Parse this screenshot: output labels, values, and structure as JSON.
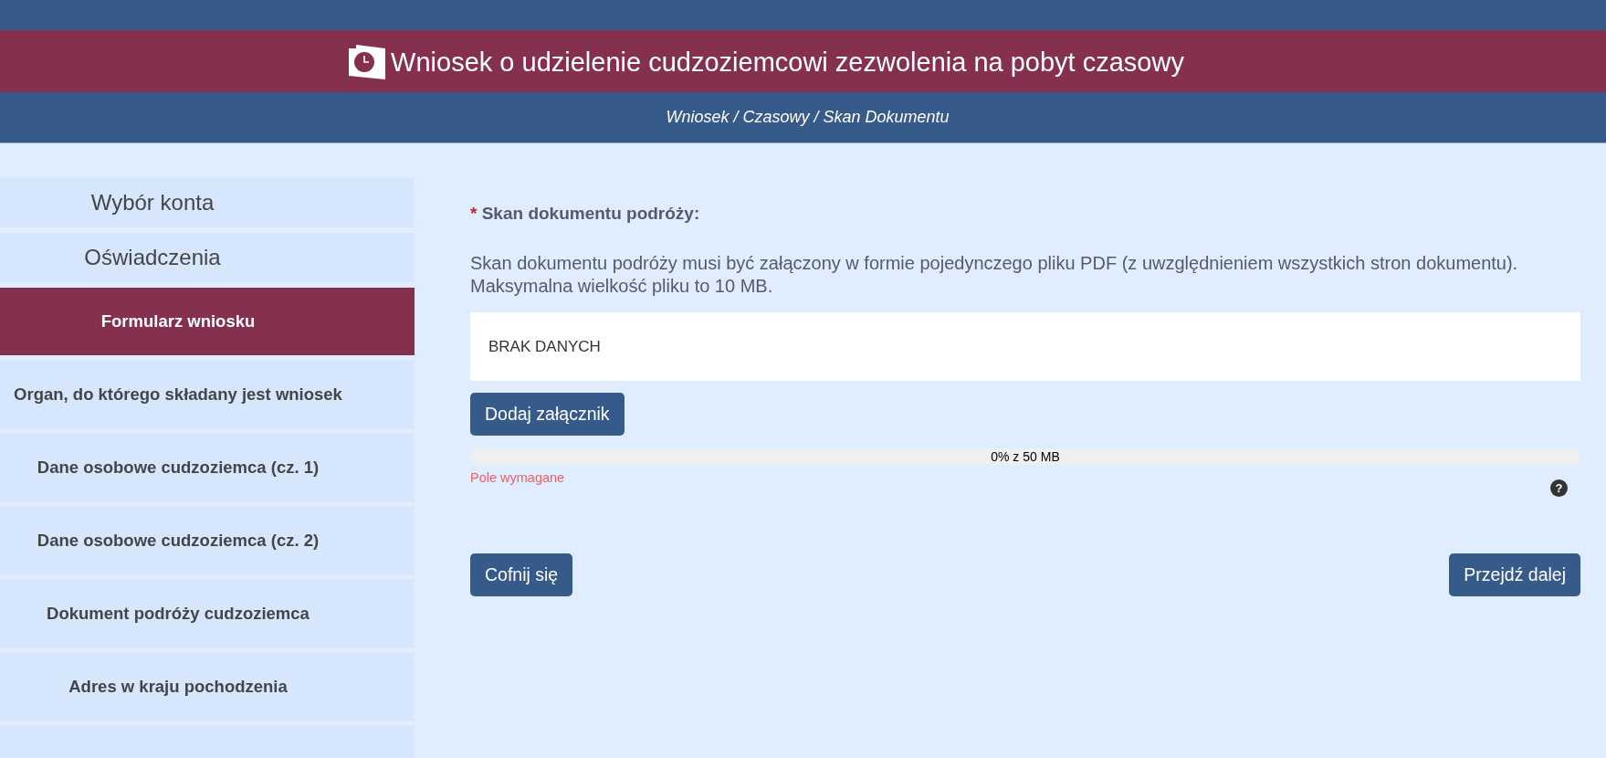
{
  "header": {
    "title": "Wniosek o udzielenie cudzoziemcowi zezwolenia na pobyt czasowy"
  },
  "breadcrumb": "Wniosek / Czasowy / Skan Dokumentu",
  "sidebar": {
    "items": [
      {
        "label": "Wybór konta",
        "kind": "page",
        "selected": false
      },
      {
        "label": "Oświadczenia",
        "kind": "page",
        "selected": false
      },
      {
        "label": "Formularz wniosku",
        "kind": "step",
        "selected": true
      },
      {
        "label": "Organ, do którego składany jest wniosek",
        "kind": "step",
        "selected": false
      },
      {
        "label": "Dane osobowe cudzoziemca (cz. 1)",
        "kind": "step",
        "selected": false
      },
      {
        "label": "Dane osobowe cudzoziemca (cz. 2)",
        "kind": "step",
        "selected": false
      },
      {
        "label": "Dokument podróży cudzoziemca",
        "kind": "step",
        "selected": false
      },
      {
        "label": "Adres w kraju pochodzenia",
        "kind": "step",
        "selected": false
      },
      {
        "kind": "step",
        "selected": false
      }
    ]
  },
  "form": {
    "required_mark": "*",
    "label": "Skan dokumentu podróży:",
    "description": "Skan dokumentu podróży musi być załączony w formie pojedynczego pliku PDF (z uwzględnieniem wszystkich stron dokumentu). Maksymalna wielkość pliku to 10 MB.",
    "attachments": {
      "value": "BRAK DANYCH"
    },
    "add_button": "Dodaj załącznik",
    "upload": {
      "level": 0,
      "reading": "0% z 50 MB"
    },
    "error": "Pole wymagane",
    "help": "?"
  },
  "buttons": [
    {
      "label": "Cofnij się",
      "kind": "back"
    },
    {
      "label": "Przejdź dalej",
      "kind": "next"
    }
  ]
}
